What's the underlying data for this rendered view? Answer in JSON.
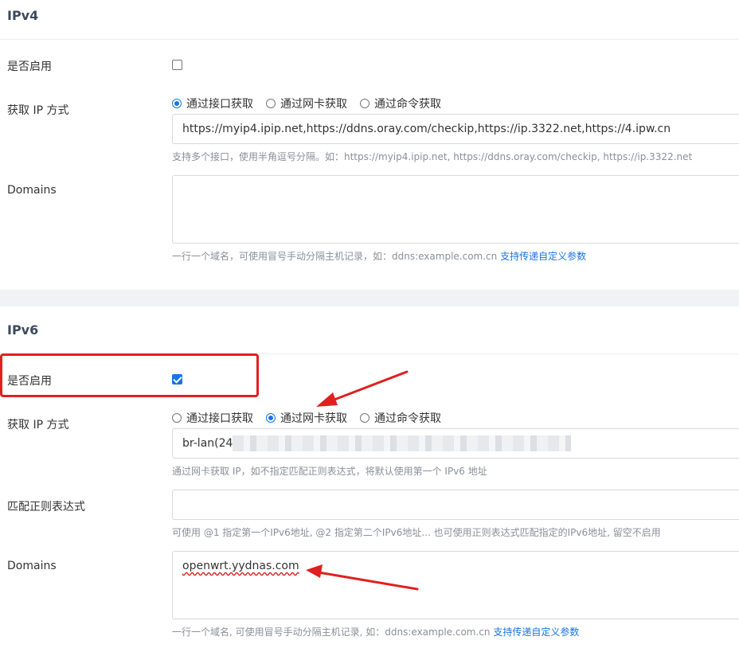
{
  "ipv4": {
    "title": "IPv4",
    "enable_label": "是否启用",
    "enabled": false,
    "method_label": "获取 IP 方式",
    "methods": [
      "通过接口获取",
      "通过网卡获取",
      "通过命令获取"
    ],
    "selected_method": 0,
    "url_value": "https://myip4.ipip.net,https://ddns.oray.com/checkip,https://ip.3322.net,https://4.ipw.cn",
    "url_hint": "支持多个接口，使用半角逗号分隔。如：https://myip4.ipip.net, https://ddns.oray.com/checkip, https://ip.3322.net",
    "domains_label": "Domains",
    "domains_value": "",
    "domains_hint": "一行一个域名，可使用冒号手动分隔主机记录，如：ddns:example.com.cn",
    "domains_hint_link": "支持传递自定义参数"
  },
  "ipv6": {
    "title": "IPv6",
    "enable_label": "是否启用",
    "enabled": true,
    "method_label": "获取 IP 方式",
    "methods": [
      "通过接口获取",
      "通过网卡获取",
      "通过命令获取"
    ],
    "selected_method": 1,
    "interface_value": "br-lan(24",
    "interface_hint": "通过网卡获取 IP，如不指定匹配正则表达式，将默认使用第一个 IPv6 地址",
    "regex_label": "匹配正则表达式",
    "regex_value": "",
    "regex_hint": "可使用 @1 指定第一个IPv6地址, @2 指定第二个IPv6地址... 也可使用正则表达式匹配指定的IPv6地址, 留空不启用",
    "domains_label": "Domains",
    "domains_value": "openwrt.yydnas.com",
    "domains_hint": "一行一个域名, 可使用冒号手动分隔主机记录, 如：ddns:example.com.cn",
    "domains_hint_link": "支持传递自定义参数"
  },
  "colors": {
    "accent": "#1a73e8",
    "annotation": "#e02020"
  }
}
